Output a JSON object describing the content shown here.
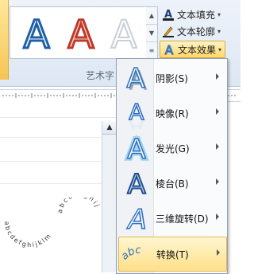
{
  "ribbon": {
    "commands": {
      "fill_label": "文本填充",
      "outline_label": "文本轮廓",
      "effects_label": "文本效果"
    },
    "group_label": "艺术字",
    "gallery_letter": "A"
  },
  "menu": {
    "items": [
      {
        "label": "阴影(S)",
        "icon": "shadow-icon"
      },
      {
        "label": "映像(R)",
        "icon": "reflection-icon"
      },
      {
        "label": "发光(G)",
        "icon": "glow-icon"
      },
      {
        "label": "棱台(B)",
        "icon": "bevel-icon"
      },
      {
        "label": "三维旋转(D)",
        "icon": "3d-rotation-icon"
      },
      {
        "label": "转换(T)",
        "icon": "transform-icon"
      }
    ],
    "highlighted": "转换(T)"
  },
  "document": {
    "warp_text_1": "abcdefghijklm",
    "warp_text_2": "abcdefghij"
  },
  "colors": {
    "accent": "#1f5fa8",
    "highlight": "#ffd86a",
    "red": "#c0392b"
  }
}
